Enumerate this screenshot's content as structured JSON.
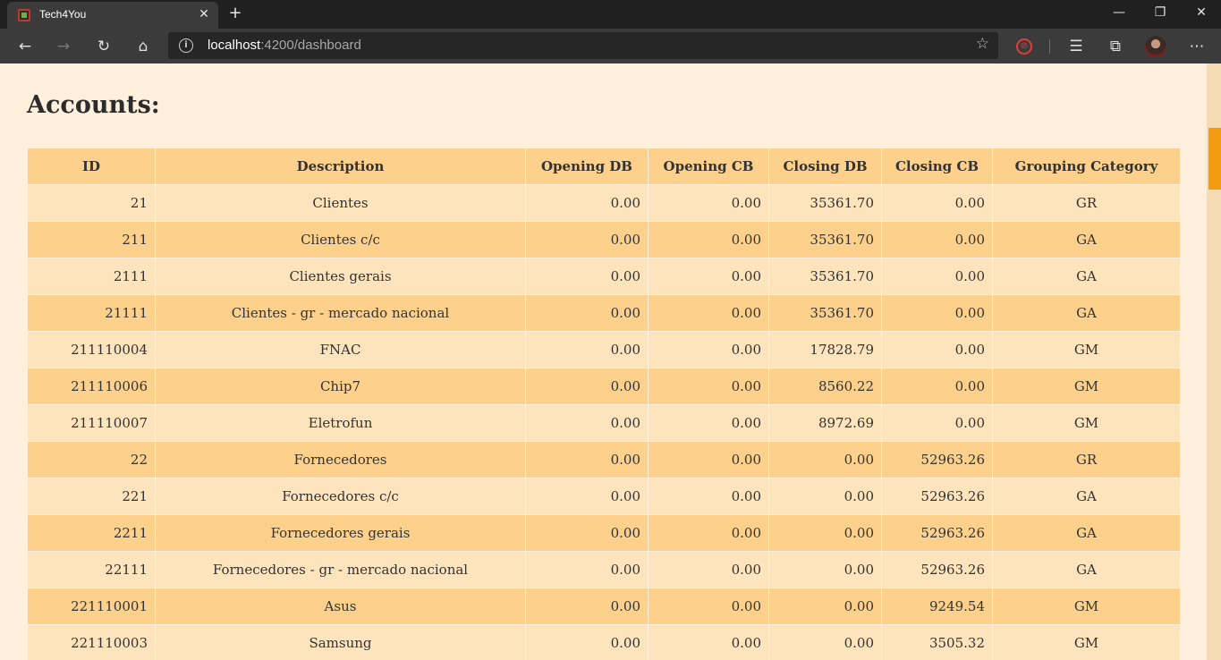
{
  "browser": {
    "tab_title": "Tech4You",
    "tab_close": "✕",
    "new_tab": "+",
    "url_host": "localhost",
    "url_rest": ":4200/dashboard",
    "win_min": "—",
    "win_max": "❐",
    "win_close": "✕",
    "icons": [
      "back-icon",
      "forward-icon",
      "refresh-icon",
      "home-icon",
      "info-icon",
      "star-icon",
      "extension-icon",
      "favorites-icon",
      "collections-icon",
      "profile-avatar",
      "more-icon"
    ]
  },
  "page": {
    "title": "Accounts:"
  },
  "table": {
    "columns": [
      "ID",
      "Description",
      "Opening DB",
      "Opening CB",
      "Closing DB",
      "Closing CB",
      "Grouping Category"
    ],
    "rows": [
      [
        "21",
        "Clientes",
        "0.00",
        "0.00",
        "35361.70",
        "0.00",
        "GR"
      ],
      [
        "211",
        "Clientes c/c",
        "0.00",
        "0.00",
        "35361.70",
        "0.00",
        "GA"
      ],
      [
        "2111",
        "Clientes gerais",
        "0.00",
        "0.00",
        "35361.70",
        "0.00",
        "GA"
      ],
      [
        "21111",
        "Clientes - gr - mercado nacional",
        "0.00",
        "0.00",
        "35361.70",
        "0.00",
        "GA"
      ],
      [
        "211110004",
        "FNAC",
        "0.00",
        "0.00",
        "17828.79",
        "0.00",
        "GM"
      ],
      [
        "211110006",
        "Chip7",
        "0.00",
        "0.00",
        "8560.22",
        "0.00",
        "GM"
      ],
      [
        "211110007",
        "Eletrofun",
        "0.00",
        "0.00",
        "8972.69",
        "0.00",
        "GM"
      ],
      [
        "22",
        "Fornecedores",
        "0.00",
        "0.00",
        "0.00",
        "52963.26",
        "GR"
      ],
      [
        "221",
        "Fornecedores c/c",
        "0.00",
        "0.00",
        "0.00",
        "52963.26",
        "GA"
      ],
      [
        "2211",
        "Fornecedores gerais",
        "0.00",
        "0.00",
        "0.00",
        "52963.26",
        "GA"
      ],
      [
        "22111",
        "Fornecedores - gr - mercado nacional",
        "0.00",
        "0.00",
        "0.00",
        "52963.26",
        "GA"
      ],
      [
        "221110001",
        "Asus",
        "0.00",
        "0.00",
        "0.00",
        "9249.54",
        "GM"
      ],
      [
        "221110003",
        "Samsung",
        "0.00",
        "0.00",
        "0.00",
        "3505.32",
        "GM"
      ]
    ]
  },
  "colors": {
    "page_bg": "#fef0dc",
    "header_bg": "#fdd18c",
    "row_light": "#fde4bd",
    "row_dark": "#fdd08b",
    "scroll_thumb": "#f39c12"
  }
}
